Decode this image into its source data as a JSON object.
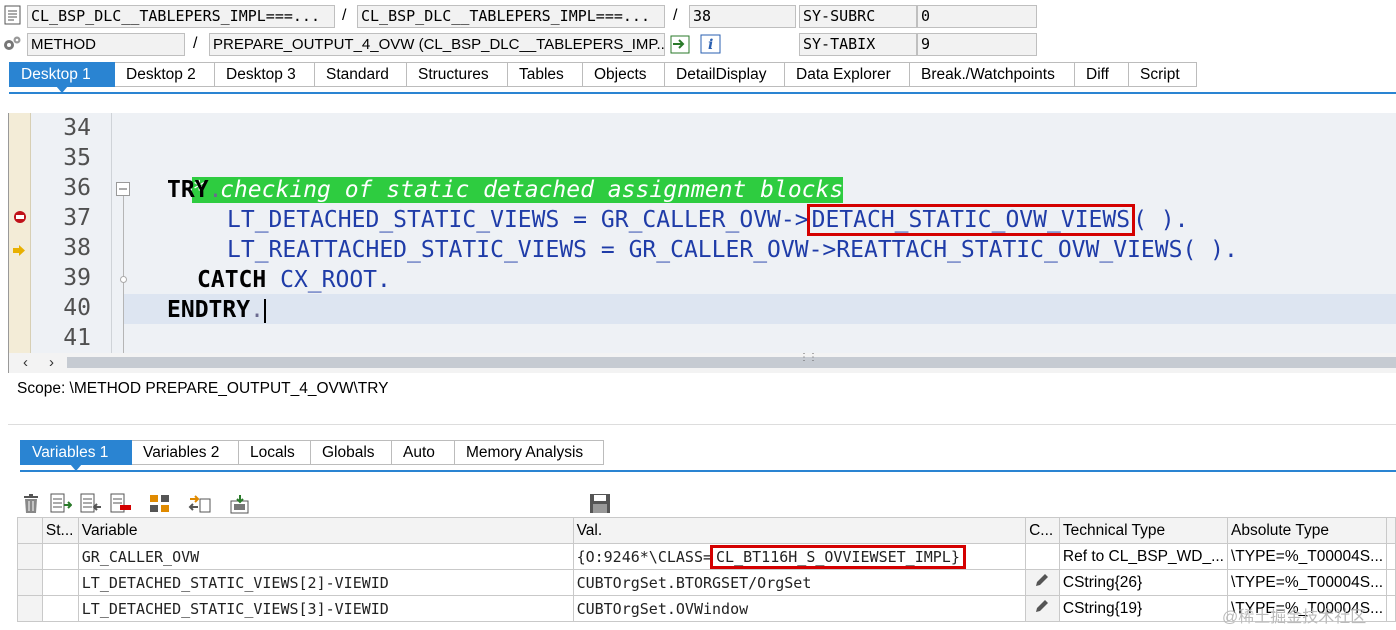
{
  "header": {
    "program": "CL_BSP_DLC__TABLEPERS_IMPL===...",
    "include": "CL_BSP_DLC__TABLEPERS_IMPL===...",
    "line": "38",
    "event_type": "METHOD",
    "event": "PREPARE_OUTPUT_4_OVW (CL_BSP_DLC__TABLEPERS_IMP...",
    "sys1_name": "SY-SUBRC",
    "sys1_value": "0",
    "sys2_name": "SY-TABIX",
    "sys2_value": "9",
    "slash": "/"
  },
  "main_tabs": [
    "Desktop 1",
    "Desktop 2",
    "Desktop 3",
    "Standard",
    "Structures",
    "Tables",
    "Objects",
    "DetailDisplay",
    "Data Explorer",
    "Break./Watchpoints",
    "Diff",
    "Script"
  ],
  "code": {
    "lines": [
      {
        "no": "34"
      },
      {
        "no": "35",
        "comment": "* checking of static detached assignment blocks"
      },
      {
        "no": "36",
        "kw": "TRY",
        "dot": "."
      },
      {
        "no": "37",
        "pre": "LT_DETACHED_STATIC_VIEWS = GR_CALLER_OVW->",
        "hl": "DETACH_STATIC_OVW_VIEWS",
        "post": "( )."
      },
      {
        "no": "38",
        "pre": "LT_REATTACHED_STATIC_VIEWS = GR_CALLER_OVW->REATTACH_STATIC_OVW_VIEWS( )."
      },
      {
        "no": "39",
        "kw": "CATCH",
        "rest": " CX_ROOT."
      },
      {
        "no": "40",
        "kw": "ENDTRY",
        "dot": "."
      },
      {
        "no": "41"
      }
    ]
  },
  "scope": "Scope: \\METHOD PREPARE_OUTPUT_4_OVW\\TRY",
  "var_tabs": [
    "Variables 1",
    "Variables 2",
    "Locals",
    "Globals",
    "Auto",
    "Memory Analysis"
  ],
  "var_table": {
    "headers": [
      "St...",
      "Variable",
      "Val.",
      "C...",
      "Technical Type",
      "Absolute Type"
    ],
    "rows": [
      {
        "variable": "GR_CALLER_OVW",
        "val_pre": "{O:9246*\\CLASS=",
        "val_hl": "CL_BT116H_S_OVVIEWSET_IMPL}",
        "tech": "Ref to CL_BSP_WD_...",
        "abs": "\\TYPE=%_T00004S..."
      },
      {
        "variable": "LT_DETACHED_STATIC_VIEWS[2]-VIEWID",
        "val_pre": "CUBTOrgSet.BTORGSET/OrgSet",
        "tech": "CString{26}",
        "abs": "\\TYPE=%_T00004S..."
      },
      {
        "variable": "LT_DETACHED_STATIC_VIEWS[3]-VIEWID",
        "val_pre": "CUBTOrgSet.OVWindow",
        "tech": "CString{19}",
        "abs": "\\TYPE=%_T00004S..."
      }
    ]
  },
  "watermark": "@稀土掘金技术社区",
  "colors": {
    "accent": "#2a84d2",
    "comment_bg": "#2ecc40",
    "highlight_box": "#d40000"
  }
}
